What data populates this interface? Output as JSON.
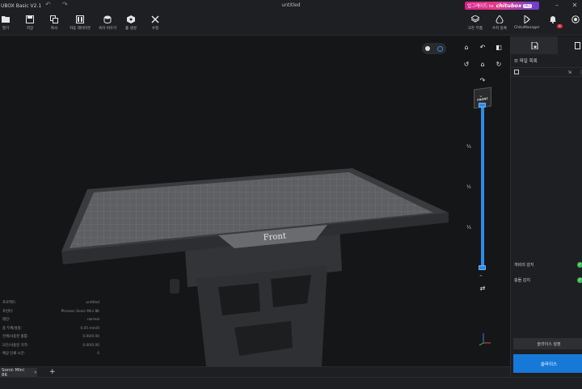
{
  "titlebar": {
    "app_title": "UBOX Basic  V2.1",
    "document": "untitled",
    "promo": {
      "text": "업그레이드 to",
      "brand": "chitubox",
      "badge": "PRO"
    }
  },
  "toolbar": {
    "left": [
      {
        "label": "열기",
        "icon": "folder-icon"
      },
      {
        "label": "저장",
        "icon": "save-icon"
      },
      {
        "label": "복사",
        "icon": "copy-icon"
      },
      {
        "label": "자동 레이아웃",
        "icon": "auto-layout-icon"
      },
      {
        "label": "속이 비우기",
        "icon": "hollow-icon"
      },
      {
        "label": "홀 생성",
        "icon": "hole-icon"
      },
      {
        "label": "수정",
        "icon": "repair-icon"
      }
    ],
    "right": [
      {
        "label": "모든 부품",
        "icon": "all-parts-icon"
      },
      {
        "label": "수지 등록",
        "icon": "resin-icon"
      },
      {
        "label": "ChituManager",
        "icon": "chitumanager-icon"
      }
    ],
    "notification_count": "4"
  },
  "viewport": {
    "bed_label": "Front",
    "cube_label": "FRONT",
    "slider_marks": [
      "¾",
      "½",
      "¼"
    ]
  },
  "info": [
    {
      "key": "프로젝트:",
      "value": "untitled"
    },
    {
      "key": "프린터:",
      "value": "Phrozen Sonic Mini 8K"
    },
    {
      "key": "레진:",
      "value": "normal"
    },
    {
      "key": "층 두께/설정:",
      "value": "0.05  mm/0"
    },
    {
      "key": "전체/사용된 볼륨:",
      "value": "0.00/0.00"
    },
    {
      "key": "모든/사용된 가격:",
      "value": "0.00/0.00"
    },
    {
      "key": "예상 인쇄 시간:",
      "value": "0"
    }
  ],
  "panel": {
    "header": "파일 목록",
    "checks": [
      {
        "label": "개비의 감지",
        "status": "ok"
      },
      {
        "label": "충돌 감지",
        "status": "ok"
      }
    ],
    "settings_button": "슬라이스 설정",
    "slice_button": "슬라이스"
  },
  "bottom": {
    "printer_tab": "Sonic Mini 8K",
    "add_tab": "+"
  }
}
